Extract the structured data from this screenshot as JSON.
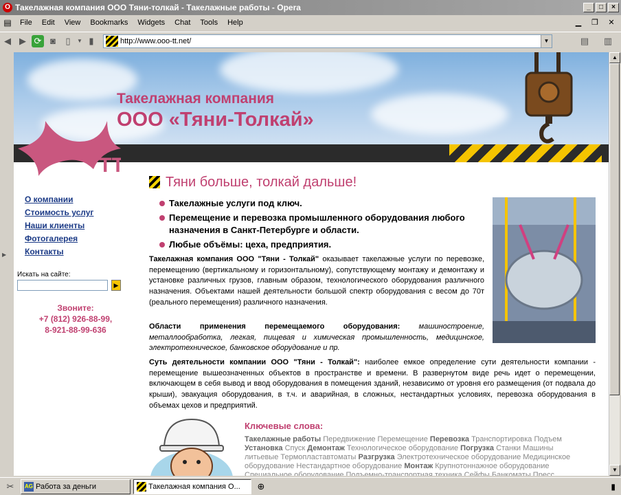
{
  "window": {
    "title": "Такелажная компания ООО Тяни-толкай - Такелажные работы - Opera"
  },
  "menu": [
    "File",
    "Edit",
    "View",
    "Bookmarks",
    "Widgets",
    "Chat",
    "Tools",
    "Help"
  ],
  "address": {
    "url": "http://www.ooo-tt.net/"
  },
  "header": {
    "company_line1": "Такелажная компания",
    "company_line2": "ООО «Тяни-Толкай»",
    "logo_letters": "ТТ"
  },
  "nav": [
    "О компании",
    "Стоимость услуг",
    "Наши клиенты",
    "Фотогалерея",
    "Контакты"
  ],
  "search": {
    "label": "Искать на сайте:",
    "button_glyph": "▶"
  },
  "contacts": {
    "heading": "Звоните:",
    "phone1": "+7 (812) 926-88-99,",
    "phone2": "8-921-88-99-636"
  },
  "main": {
    "headline": "Тяни больше, толкай дальше!",
    "bullets": [
      "Такелажные услуги под ключ.",
      "Перемещение и перевозка промышленного оборудования любого назначения в Санкт-Петербурге и области.",
      "Любые объёмы: цеха, предприятия."
    ],
    "p1_bold": "Такелажная компания ООО \"Тяни - Толкай\"",
    "p1_text": " оказывает такелажные услуги по перевозке, перемещению (вертикальному и горизонтальному), сопутствующему монтажу и демонтажу и установке различных грузов, главным образом, технологического оборудования различного назначения. Объектами нашей деятельности большой спектр оборудования с весом до 70т (реального перемещения) различного назначения.",
    "p2_bold": "Области применения перемещаемого оборудования:",
    "p2_italic": " машиностроение, металлообработка, легкая, пищевая и химическая промышленность, медицинское, электротехническое, банковское оборудование и пр.",
    "p3_bold": "Суть деятельности компании ООО \"Тяни - Толкай\":",
    "p3_text": " наиболее емкое определение сути деятельности компании - перемещение вышеозначенных объектов в пространстве и времени. В развернутом виде речь идет о перемещении, включающем в себя вывод и ввод оборудования в помещения зданий, независимо от уровня его размещения (от подвала до крыши), эвакуация оборудования, в т.ч. и аварийная, в сложных, нестандартных условиях, перевозка оборудования в объемах цехов и предприятий.",
    "keywords_title": "Ключевые слова:",
    "keywords": [
      {
        "t": "Такелажные работы",
        "b": true
      },
      {
        "t": " Передвижение Перемещение ",
        "b": false
      },
      {
        "t": "Перевозка",
        "b": true
      },
      {
        "t": " Транспортировка Подъем ",
        "b": false
      },
      {
        "t": "Установка",
        "b": true
      },
      {
        "t": " Спуск ",
        "b": false
      },
      {
        "t": "Демонтаж",
        "b": true
      },
      {
        "t": " Технологическое оборудование ",
        "b": false
      },
      {
        "t": "Погрузка",
        "b": true
      },
      {
        "t": " Станки Машины литьевые Термопластавтоматы ",
        "b": false
      },
      {
        "t": "Разгрузка",
        "b": true
      },
      {
        "t": " Электротехническое оборудование Медицинское оборудование Нестандартное оборудование ",
        "b": false
      },
      {
        "t": "Монтаж",
        "b": true
      },
      {
        "t": " Крупнотоннажное оборудование Специальное оборудование Подъемно-транспортная техника Сейфы Банкоматы Пресс",
        "b": false
      }
    ]
  },
  "taskbar": {
    "tab1": "Работа за деньги",
    "tab1_icon": "AG",
    "tab2": "Такелажная компания О..."
  }
}
